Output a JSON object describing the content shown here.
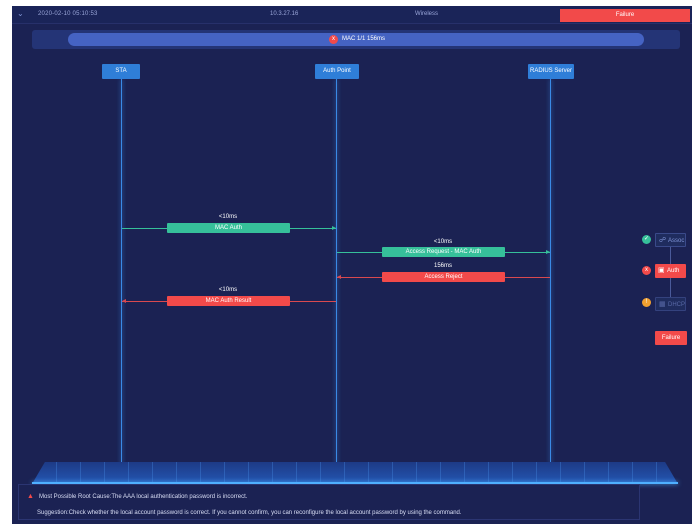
{
  "header": {
    "collapse_icon": "chevron-down-icon",
    "timestamp": "2020-02-10 05:10:53",
    "ip": "10.3.27.16",
    "network": "Wireless",
    "status": "Failure"
  },
  "summary": {
    "status_glyph": "x",
    "text": "MAC 1/1 156ms"
  },
  "actors": {
    "sta": "STA",
    "ap": "Auth Point",
    "radius": "RADIUS Server"
  },
  "messages": [
    {
      "latency": "<10ms",
      "label": "MAC Auth",
      "status": "success"
    },
    {
      "latency": "<10ms",
      "label": "Access Request - MAC Auth",
      "status": "success"
    },
    {
      "latency": "156ms",
      "label": "Access Reject",
      "status": "failure"
    },
    {
      "latency": "<10ms",
      "label": "MAC Auth Result",
      "status": "failure"
    }
  ],
  "stages": [
    {
      "label": "Assoc",
      "status": "success",
      "icon": "link-icon",
      "status_glyph": "✓"
    },
    {
      "label": "Auth",
      "status": "failure",
      "icon": "lock-icon",
      "status_glyph": "x"
    },
    {
      "label": "DHCP",
      "status": "pending",
      "icon": "network-icon",
      "status_glyph": "!"
    }
  ],
  "stage_result": "Failure",
  "cause": {
    "warning_icon": "warning-icon",
    "root_cause": "Most Possible Root Cause:The AAA local authentication password is incorrect.",
    "suggestion": "Suggestion:Check whether the local account password is correct. If you cannot confirm, you can reconfigure the local account password by using the command."
  },
  "colors": {
    "background": "#1b2253",
    "lifeline": "#3a8ae6",
    "success": "#36c09a",
    "failure": "#f24a4a",
    "actor": "#2f7ed8"
  }
}
